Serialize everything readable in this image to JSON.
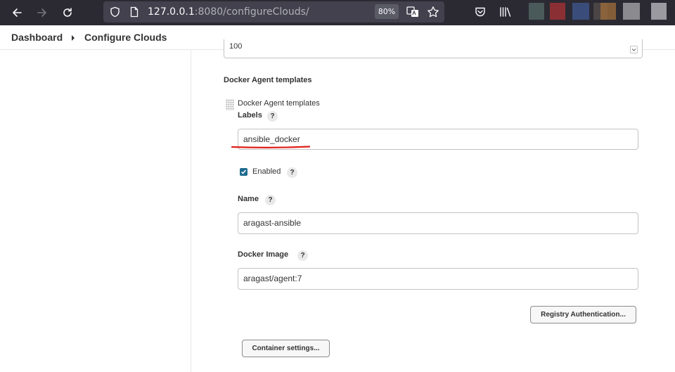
{
  "browser": {
    "url_host": "127.0.0.1",
    "url_rest": ":8080/configureClouds/",
    "zoom": "80%",
    "icons": [
      "back-arrow-icon",
      "forward-arrow-icon",
      "reload-icon",
      "shield-icon",
      "page-icon",
      "translate-icon",
      "star-icon",
      "pocket-icon",
      "library-icon"
    ]
  },
  "breadcrumb": {
    "items": [
      "Dashboard",
      "Configure Clouds"
    ]
  },
  "form": {
    "top_field_value": "100",
    "section_title": "Docker Agent templates",
    "template_title": "Docker Agent templates",
    "labels": {
      "label": "Labels",
      "value": "ansible_docker",
      "help": "?"
    },
    "enabled": {
      "label": "Enabled",
      "checked": true,
      "help": "?"
    },
    "name": {
      "label": "Name",
      "value": "aragast-ansible",
      "help": "?"
    },
    "docker_image": {
      "label": "Docker Image",
      "value": "aragast/agent:7",
      "help": "?"
    },
    "registry_button": "Registry Authentication...",
    "container_button": "Container settings..."
  },
  "colors": {
    "browser_bg": "#2b2a33",
    "urlbar_bg": "#42414d",
    "checkbox": "#1e6b8f",
    "annotation": "#e0201a"
  }
}
